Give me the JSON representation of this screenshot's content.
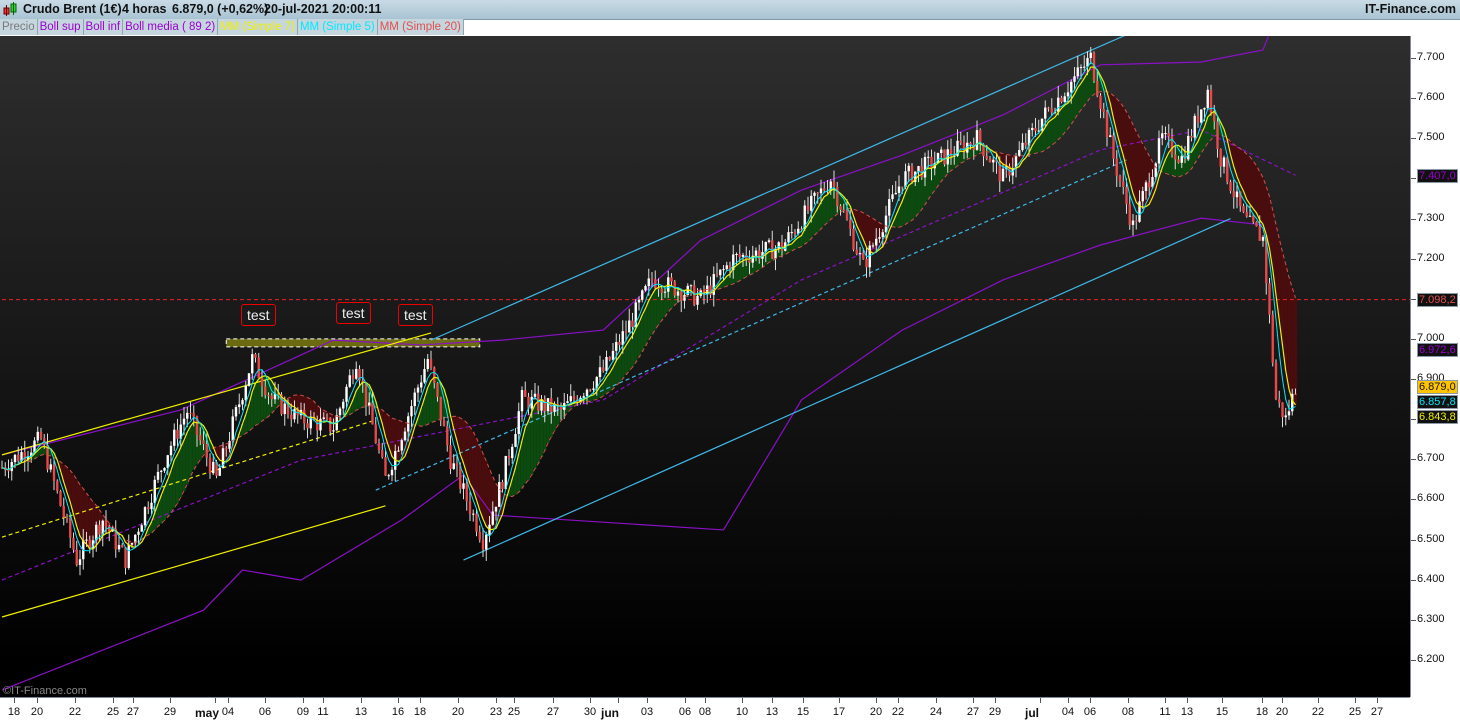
{
  "header": {
    "instrument": "Crudo Brent (1€)",
    "timeframe": "4 horas",
    "last": "6.879,0 (+0,62%)",
    "datetime": "20-jul-2021 20:00:11",
    "brand": "IT-Finance.com"
  },
  "legend": [
    {
      "label": "Precio",
      "color": "#7a7a7a"
    },
    {
      "label": "Boll sup",
      "color": "#9b00d0"
    },
    {
      "label": "Boll inf",
      "color": "#9b00d0"
    },
    {
      "label": "Boll media ( 89 2)",
      "color": "#9b00d0"
    },
    {
      "label": "MM (Simple 7)",
      "color": "#f0f000"
    },
    {
      "label": "MM (Simple 5)",
      "color": "#00e8ff"
    },
    {
      "label": "MM (Simple 20)",
      "color": "#e05050"
    }
  ],
  "watermark": "©IT-Finance.com",
  "annotations": {
    "test_labels": [
      "test",
      "test",
      "test"
    ]
  },
  "chart_data": {
    "type": "candlestick",
    "title": "Crudo Brent (1€) 4 horas",
    "ylim": [
      6.12,
      7.77
    ],
    "yticks": [
      "7.700",
      "7.600",
      "7.500",
      "7.400",
      "7.300",
      "7.200",
      "7.100",
      "7.000",
      "6.900",
      "6.800",
      "6.700",
      "6.600",
      "6.500",
      "6.400",
      "6.300",
      "6.200"
    ],
    "ytick_values": [
      7.7,
      7.6,
      7.5,
      7.4,
      7.3,
      7.2,
      7.1,
      7.0,
      6.9,
      6.8,
      6.7,
      6.6,
      6.5,
      6.4,
      6.3,
      6.2
    ],
    "xticks": [
      {
        "label": "18",
        "bold": false
      },
      {
        "label": "20",
        "bold": false
      },
      {
        "label": "22",
        "bold": false
      },
      {
        "label": "25",
        "bold": false
      },
      {
        "label": "27",
        "bold": false
      },
      {
        "label": "29",
        "bold": false
      },
      {
        "label": "may",
        "bold": true
      },
      {
        "label": "04",
        "bold": false
      },
      {
        "label": "06",
        "bold": false
      },
      {
        "label": "09",
        "bold": false
      },
      {
        "label": "11",
        "bold": false
      },
      {
        "label": "13",
        "bold": false
      },
      {
        "label": "16",
        "bold": false
      },
      {
        "label": "18",
        "bold": false
      },
      {
        "label": "20",
        "bold": false
      },
      {
        "label": "23",
        "bold": false
      },
      {
        "label": "25",
        "bold": false
      },
      {
        "label": "27",
        "bold": false
      },
      {
        "label": "30",
        "bold": false
      },
      {
        "label": "jun",
        "bold": true
      },
      {
        "label": "03",
        "bold": false
      },
      {
        "label": "06",
        "bold": false
      },
      {
        "label": "08",
        "bold": false
      },
      {
        "label": "10",
        "bold": false
      },
      {
        "label": "13",
        "bold": false
      },
      {
        "label": "15",
        "bold": false
      },
      {
        "label": "17",
        "bold": false
      },
      {
        "label": "20",
        "bold": false
      },
      {
        "label": "22",
        "bold": false
      },
      {
        "label": "24",
        "bold": false
      },
      {
        "label": "27",
        "bold": false
      },
      {
        "label": "29",
        "bold": false
      },
      {
        "label": "jul",
        "bold": true
      },
      {
        "label": "04",
        "bold": false
      },
      {
        "label": "06",
        "bold": false
      },
      {
        "label": "08",
        "bold": false
      },
      {
        "label": "11",
        "bold": false
      },
      {
        "label": "13",
        "bold": false
      },
      {
        "label": "15",
        "bold": false
      },
      {
        "label": "18",
        "bold": false
      },
      {
        "label": "20",
        "bold": false
      },
      {
        "label": "22",
        "bold": false
      },
      {
        "label": "25",
        "bold": false
      },
      {
        "label": "27",
        "bold": false
      }
    ],
    "price_path": [
      [
        0,
        6.68
      ],
      [
        12,
        6.75
      ],
      [
        23,
        6.45
      ],
      [
        31,
        6.55
      ],
      [
        38,
        6.45
      ],
      [
        51,
        6.72
      ],
      [
        57,
        6.82
      ],
      [
        66,
        6.65
      ],
      [
        77,
        6.95
      ],
      [
        83,
        6.85
      ],
      [
        92,
        6.8
      ],
      [
        102,
        6.78
      ],
      [
        109,
        6.95
      ],
      [
        118,
        6.65
      ],
      [
        131,
        6.95
      ],
      [
        138,
        6.7
      ],
      [
        148,
        6.5
      ],
      [
        154,
        6.65
      ],
      [
        160,
        6.85
      ],
      [
        172,
        6.82
      ],
      [
        185,
        6.92
      ],
      [
        194,
        7.05
      ],
      [
        200,
        7.15
      ],
      [
        215,
        7.1
      ],
      [
        225,
        7.2
      ],
      [
        240,
        7.23
      ],
      [
        255,
        7.4
      ],
      [
        265,
        7.18
      ],
      [
        277,
        7.4
      ],
      [
        289,
        7.45
      ],
      [
        300,
        7.5
      ],
      [
        308,
        7.4
      ],
      [
        320,
        7.55
      ],
      [
        335,
        7.7
      ],
      [
        342,
        7.45
      ],
      [
        348,
        7.28
      ],
      [
        357,
        7.5
      ],
      [
        363,
        7.45
      ],
      [
        371,
        7.62
      ],
      [
        375,
        7.45
      ],
      [
        382,
        7.3
      ],
      [
        388,
        7.25
      ],
      [
        392,
        6.85
      ],
      [
        395,
        6.8
      ],
      [
        398,
        6.88
      ]
    ],
    "boll_sup": [
      [
        0,
        6.711
      ],
      [
        55,
        6.823
      ],
      [
        102,
        6.997
      ],
      [
        129,
        6.985
      ],
      [
        154,
        6.997
      ],
      [
        185,
        7.022
      ],
      [
        215,
        7.246
      ],
      [
        246,
        7.371
      ],
      [
        277,
        7.458
      ],
      [
        308,
        7.558
      ],
      [
        338,
        7.683
      ],
      [
        369,
        7.69
      ],
      [
        388,
        7.72
      ],
      [
        394,
        7.845
      ]
    ],
    "boll_inf": [
      [
        0,
        6.125
      ],
      [
        62,
        6.324
      ],
      [
        74,
        6.424
      ],
      [
        92,
        6.399
      ],
      [
        123,
        6.549
      ],
      [
        142,
        6.661
      ],
      [
        151,
        6.561
      ],
      [
        222,
        6.524
      ],
      [
        246,
        6.848
      ],
      [
        277,
        7.022
      ],
      [
        308,
        7.147
      ],
      [
        338,
        7.234
      ],
      [
        369,
        7.301
      ],
      [
        388,
        7.284
      ]
    ],
    "boll_media": [
      [
        0,
        6.399
      ],
      [
        92,
        6.698
      ],
      [
        185,
        6.848
      ],
      [
        246,
        7.147
      ],
      [
        338,
        7.471
      ],
      [
        369,
        7.521
      ],
      [
        398,
        7.408
      ]
    ],
    "trendlines": [
      {
        "name": "yellow-channel-upper",
        "color": "#f0f000",
        "dash": false,
        "pts": [
          [
            0,
            6.711
          ],
          [
            132,
            7.015
          ]
        ]
      },
      {
        "name": "yellow-channel-lower",
        "color": "#f0f000",
        "dash": false,
        "pts": [
          [
            0,
            6.307
          ],
          [
            118,
            6.584
          ]
        ]
      },
      {
        "name": "yellow-channel-mid",
        "color": "#f0f000",
        "dash": true,
        "pts": [
          [
            0,
            6.506
          ],
          [
            115,
            6.798
          ]
        ]
      },
      {
        "name": "blue-channel-upper",
        "color": "#40b8e8",
        "dash": false,
        "pts": [
          [
            132,
            6.997
          ],
          [
            355,
            7.79
          ]
        ]
      },
      {
        "name": "blue-channel-lower",
        "color": "#40b8e8",
        "dash": false,
        "pts": [
          [
            142,
            6.449
          ],
          [
            378,
            7.3
          ]
        ]
      },
      {
        "name": "blue-channel-mid",
        "color": "#40b8e8",
        "dash": true,
        "pts": [
          [
            115,
            6.623
          ],
          [
            346,
            7.446
          ]
        ]
      },
      {
        "name": "resistance-7098",
        "color": "#d02020",
        "dash": true,
        "pts": [
          [
            0,
            7.098
          ],
          [
            434,
            7.098
          ]
        ]
      }
    ],
    "resistance_zone": {
      "from_bar": 69,
      "to_bar": 147,
      "low": 6.98,
      "high": 7.0
    },
    "price_tags": [
      {
        "label": "7.407,0",
        "value": 7.407,
        "color": "#9b00d0",
        "bg": "#111"
      },
      {
        "label": "7.098,2",
        "value": 7.0982,
        "color": "#e05050",
        "bg": "#111"
      },
      {
        "label": "6.972,6",
        "value": 6.9726,
        "color": "#9b00d0",
        "bg": "#111"
      },
      {
        "label": "6.879,0",
        "value": 6.879,
        "color": "#111",
        "bg": "#ffc400"
      },
      {
        "label": "6.857,8",
        "value": 6.8578,
        "color": "#00e8ff",
        "bg": "#111"
      },
      {
        "label": "6.843,8",
        "value": 6.8438,
        "color": "#f0f000",
        "bg": "#111"
      }
    ]
  }
}
